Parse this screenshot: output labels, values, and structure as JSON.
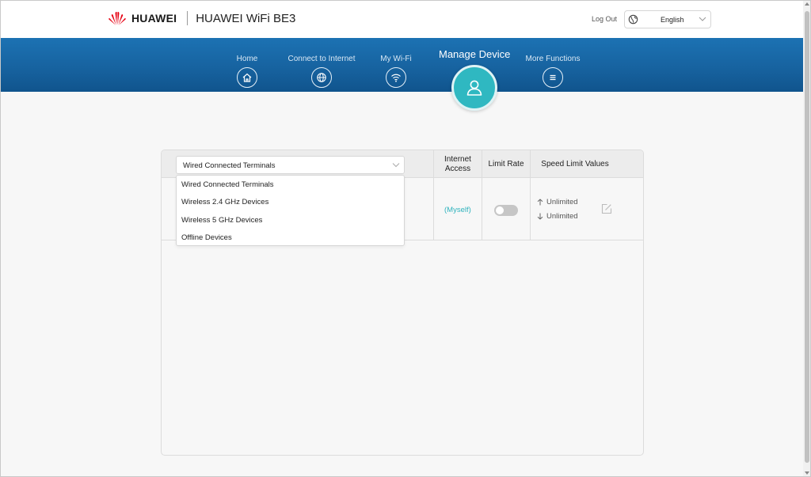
{
  "header": {
    "brand_name": "HUAWEI",
    "product_name": "HUAWEI WiFi BE3",
    "logout_label": "Log Out",
    "language": {
      "selected": "English",
      "icon": "globe-icon"
    }
  },
  "nav": {
    "items": [
      {
        "label": "Home",
        "icon": "home-icon"
      },
      {
        "label": "Connect to Internet",
        "icon": "globe-icon"
      },
      {
        "label": "My Wi-Fi",
        "icon": "wifi-icon"
      },
      {
        "label": "More Functions",
        "icon": "menu-icon"
      }
    ],
    "active": {
      "label": "Manage Device",
      "icon": "user-icon"
    }
  },
  "device_table": {
    "filter": {
      "selected": "Wired Connected Terminals",
      "options": [
        "Wired Connected Terminals",
        "Wireless 2.4 GHz Devices",
        "Wireless 5 GHz Devices",
        "Offline Devices"
      ]
    },
    "columns": {
      "internet_access": "Internet Access",
      "limit_rate": "Limit Rate",
      "speed_limit_values": "Speed Limit Values"
    },
    "rows": [
      {
        "internet_access": "(Myself)",
        "limit_rate_enabled": false,
        "upload_limit": "Unlimited",
        "download_limit": "Unlimited"
      }
    ]
  },
  "colors": {
    "accent": "#2fb8c1",
    "nav_blue": "#1763a0",
    "brand_red": "#e60012"
  }
}
